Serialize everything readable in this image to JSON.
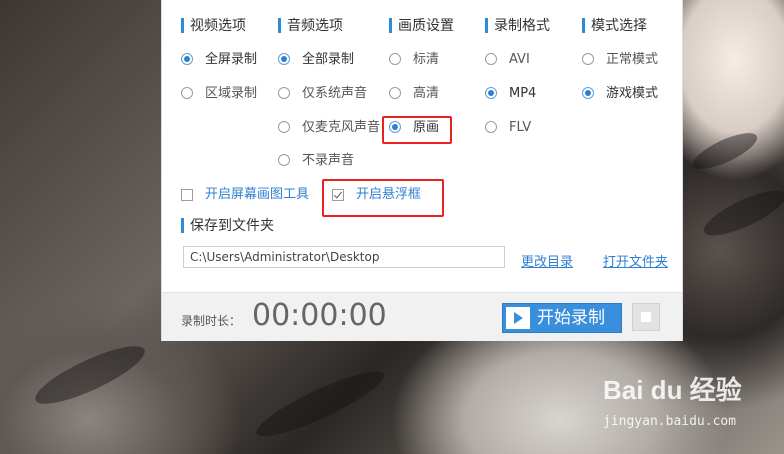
{
  "columns": {
    "video": {
      "title": "视频选项",
      "options": [
        {
          "label": "全屏录制",
          "selected": true
        },
        {
          "label": "区域录制",
          "selected": false
        }
      ]
    },
    "audio": {
      "title": "音频选项",
      "options": [
        {
          "label": "全部录制",
          "selected": true
        },
        {
          "label": "仅系统声音",
          "selected": false
        },
        {
          "label": "仅麦克风声音",
          "selected": false
        },
        {
          "label": "不录声音",
          "selected": false
        }
      ]
    },
    "quality": {
      "title": "画质设置",
      "options": [
        {
          "label": "标清",
          "selected": false
        },
        {
          "label": "高清",
          "selected": false
        },
        {
          "label": "原画",
          "selected": true
        }
      ]
    },
    "format": {
      "title": "录制格式",
      "options": [
        {
          "label": "AVI",
          "selected": false
        },
        {
          "label": "MP4",
          "selected": true
        },
        {
          "label": "FLV",
          "selected": false
        }
      ]
    },
    "mode": {
      "title": "模式选择",
      "options": [
        {
          "label": "正常模式",
          "selected": false
        },
        {
          "label": "游戏模式",
          "selected": true
        }
      ]
    }
  },
  "checkboxes": {
    "draw_tool": {
      "label": "开启屏幕画图工具",
      "checked": false
    },
    "float_window": {
      "label": "开启悬浮框",
      "checked": true
    }
  },
  "save": {
    "title": "保存到文件夹",
    "path": "C:\\Users\\Administrator\\Desktop",
    "change_dir_label": "更改目录",
    "open_folder_label": "打开文件夹"
  },
  "footer": {
    "duration_label": "录制时长：",
    "timer": "00:00:00",
    "start_label": "开始录制"
  },
  "watermark": {
    "brand": "Bai du 经验",
    "sub": "jingyan.baidu.com"
  },
  "colors": {
    "accent": "#3a8fdc",
    "highlight_box": "#e8231b"
  }
}
